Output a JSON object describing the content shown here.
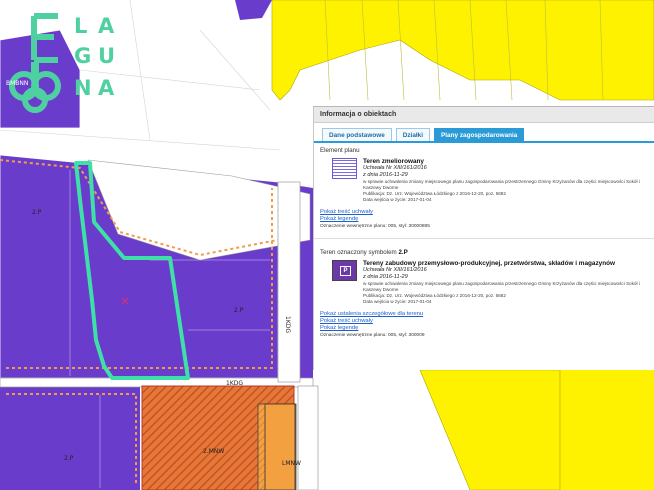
{
  "logo": {
    "letters": [
      "L",
      "A",
      "G",
      "U",
      "N",
      "A"
    ],
    "caption": "BMBNN"
  },
  "map": {
    "labels": {
      "zone_1": "2.P",
      "zone_2": "2.P",
      "zone_3": "2.P",
      "zone_4": "2.P",
      "zone_5": "2.P",
      "road_h": "1KDG",
      "road_v": "1KDG",
      "symbol_mn": "2.MNW",
      "symbol_lmnw": "LMNW"
    },
    "colors": {
      "industrial": "#6a3ccc",
      "agricultural": "#fff200",
      "plot_highlight": "#3fe0a8",
      "mixed_zone": "#e07a34",
      "orange_fill": "#f3a040",
      "zone_border": "#d24a2c"
    }
  },
  "panel": {
    "title": "Informacja o obiektach",
    "tabs": [
      {
        "label": "Dane podstawowe",
        "active": false
      },
      {
        "label": "Działki",
        "active": false
      },
      {
        "label": "Plany zagospodarowania",
        "active": true
      }
    ],
    "section1": {
      "heading": "Element planu",
      "entry_title": "Teren zmeliorowany",
      "resolution": "Uchwała Nr XIII/161/2016",
      "date": "z dnia 2016-11-29",
      "description": "w sprawie uchwalenia zmiany miejscowego planu zagospodarowania przestrzennego Gminy Krzyżanów dla części miejscowości Sokół i Kaszewy Dworne",
      "publication": "Publikacja: Dz. Urz. Województwa Łódzkiego z 2016-12-20, poz. 5682",
      "effective": "Data wejścia w życie: 2017-01-04",
      "links": [
        "Pokaż treść uchwały",
        "Pokaż legendę"
      ],
      "designation": "Oznaczenie wewnętrzne planu: 005, styl: 30000885"
    },
    "section2": {
      "heading_prefix": "Teren oznaczony symbolem",
      "symbol": "2.P",
      "swatch_letter": "P",
      "entry_title": "Tereny zabudowy przemysłowo-produkcyjnej, przetwórstwa, składów i magazynów",
      "resolution": "Uchwała Nr XIII/161/2016",
      "date": "z dnia 2016-11-29",
      "description": "w sprawie uchwalenia zmiany miejscowego planu zagospodarowania przestrzennego Gminy Krzyżanów dla części miejscowości Sokół i Kaszewy Dworne",
      "publication": "Publikacja: Dz. Urz. Województwa Łódzkiego z 2016-12-20, poz. 5682",
      "effective": "Data wejścia w życie: 2017-01-04",
      "links": [
        "Pokaż ustalenia szczegółowe dla terenu",
        "Pokaż treść uchwały",
        "Pokaż legendę"
      ],
      "designation": "Oznaczenie wewnętrzne planu: 005, styl: 300009"
    }
  }
}
